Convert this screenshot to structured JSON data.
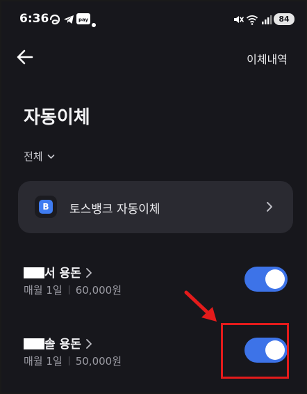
{
  "status_bar": {
    "time": "6:36",
    "icons": [
      "threads-icon",
      "telegram-icon",
      "pay-icon",
      "dot-icon",
      "mute-icon",
      "wifi-icon",
      "signal-icon"
    ],
    "pay_text": "pay",
    "battery": "84"
  },
  "header": {
    "back_icon": "arrow-left-icon",
    "history_link": "이체내역"
  },
  "page": {
    "title": "자동이체",
    "filter_label": "전체"
  },
  "toss_card": {
    "logo_letter": "B",
    "label": "토스뱅크 자동이체"
  },
  "transfers": [
    {
      "name_suffix": "서 용돈",
      "schedule": "매월 1일",
      "amount": "60,000원",
      "enabled": true
    },
    {
      "name_suffix": "솔 용돈",
      "schedule": "매월 1일",
      "amount": "50,000원",
      "enabled": true
    }
  ],
  "annotation": {
    "color": "#e41b1b"
  },
  "colors": {
    "background": "#17171c",
    "card": "#2a2a31",
    "accent": "#3d73e8"
  }
}
